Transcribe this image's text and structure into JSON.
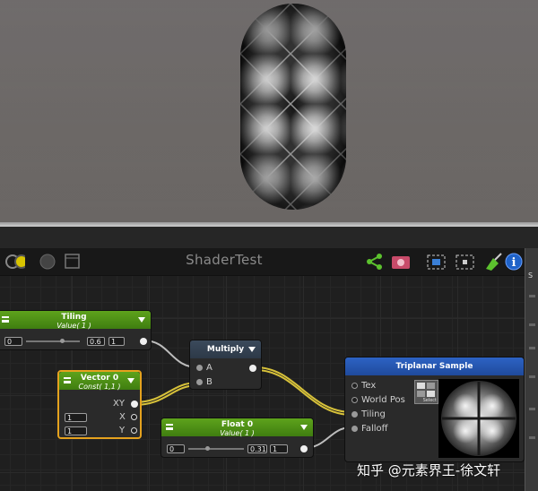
{
  "editor": {
    "title": "ShaderTest"
  },
  "toolbar_icons": [
    "share-icon",
    "camera-icon",
    "select-icon",
    "focus-icon",
    "clean-icon",
    "info-icon"
  ],
  "nodes": {
    "tiling": {
      "title": "Tiling",
      "subtitle": "Value( 1 )",
      "field1": "0",
      "field2": "0.6",
      "field3": "1"
    },
    "vector0": {
      "title": "Vector 0",
      "subtitle": "Const( 1,1 )",
      "out_label": "XY",
      "x_label": "X",
      "y_label": "Y",
      "x_value": "1",
      "y_value": "1"
    },
    "multiply": {
      "title": "Multiply",
      "in_a": "A",
      "in_b": "B"
    },
    "float0": {
      "title": "Float 0",
      "subtitle": "Value( 1 )",
      "field1": "0",
      "field2": "0.31",
      "field3": "1"
    },
    "triplanar": {
      "title": "Triplanar Sample",
      "ports": [
        "Tex",
        "World Pos",
        "Tiling",
        "Falloff"
      ],
      "select_label": "Select"
    }
  },
  "right_panel": {
    "label": "S"
  },
  "watermark": "知乎 @元素界王-徐文轩",
  "colors": {
    "node_green": "#4f9418",
    "node_blue": "#2558b5",
    "selected_outline": "#e5a21e",
    "wire_yellow": "#d8c23a",
    "wire_grey": "#bdbdbd"
  }
}
